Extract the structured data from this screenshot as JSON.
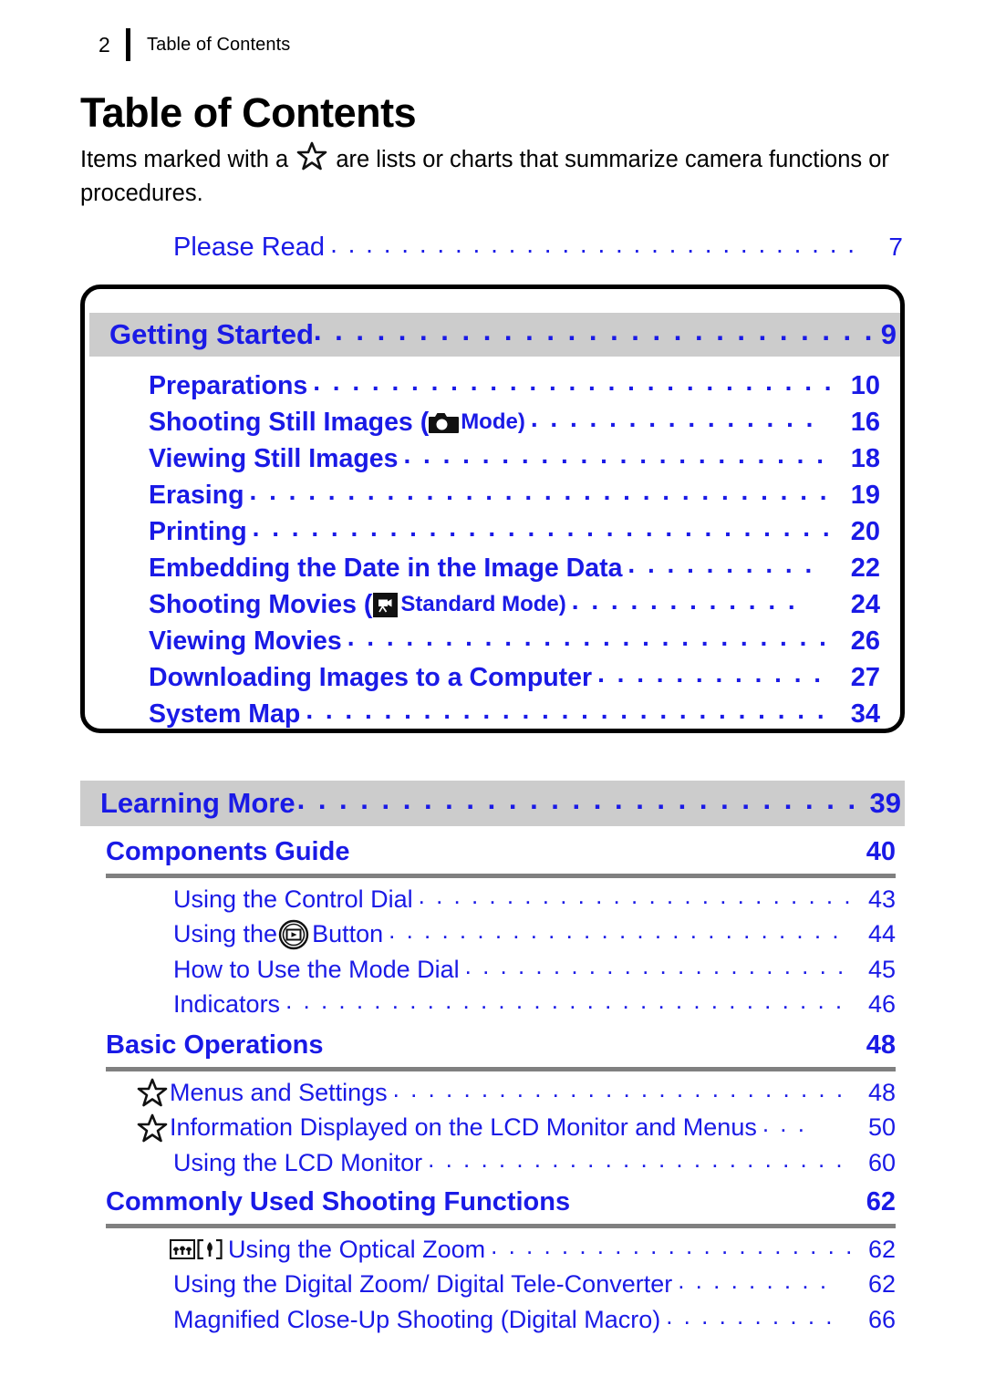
{
  "header": {
    "folio": "2",
    "title": "Table of Contents"
  },
  "title": "Table of Contents",
  "intro": {
    "before_star": "Items marked with a ",
    "star_icon": "star-icon",
    "after_star": " are lists or charts that summarize camera functions or procedures."
  },
  "colors": {
    "link_blue": "#1a1ae6",
    "banner_gray": "#cccccc",
    "rule_gray": "#808080",
    "text_black": "#000000"
  },
  "please_read": {
    "label": "Please Read",
    "leader": ". . . . . . . . . . . . . . . . . . . . . . . . . . . . . . . . . . . . .",
    "page": "7"
  },
  "getting_started": {
    "banner": {
      "label": "Getting Started",
      "leader": ". . . . . . . . . . . . . . . . . . . . . . . . . . . . . . .",
      "page": "9"
    },
    "entries": [
      {
        "label": "Preparations",
        "leader": ". . . . . . . . . . . . . . . . . . . . . . . . . . . . . .",
        "page": "10"
      },
      {
        "label_pre": "Shooting Still Images (",
        "icon": "camera-icon",
        "label_mid": " Mode)",
        "leader": ". . . . . . . . . . . . . . .",
        "page": "16"
      },
      {
        "label": "Viewing Still Images",
        "leader": ". . . . . . . . . . . . . . . . . . . . . . . . . .",
        "page": "18"
      },
      {
        "label": "Erasing",
        "leader": ". . . . . . . . . . . . . . . . . . . . . . . . . . . . . . . . .",
        "page": "19"
      },
      {
        "label": "Printing",
        "leader": ". . . . . . . . . . . . . . . . . . . . . . . . . . . . . . . .",
        "page": "20"
      },
      {
        "label": "Embedding the Date in the Image Data",
        "leader": ". . . . . . . . . .",
        "page": "22"
      },
      {
        "label_pre": "Shooting Movies (",
        "icon": "movie-icon",
        "label_mid": " Standard Mode)",
        "leader": ". . . . . . . . . . . .",
        "page": "24"
      },
      {
        "label": "Viewing Movies",
        "leader": ". . . . . . . . . . . . . . . . . . . . . . . . . . . . .",
        "page": "26"
      },
      {
        "label": "Downloading Images to a Computer",
        "leader": ". . . . . . . . . . . .",
        "page": "27"
      },
      {
        "label": "System Map",
        "leader": ". . . . . . . . . . . . . . . . . . . . . . . . . . . . . .",
        "page": "34"
      }
    ]
  },
  "learning_more": {
    "banner": {
      "label": "Learning More",
      "leader": ". . . . . . . . . . . . . . . . . . . . . . . . . . . . . . . .",
      "page": "39"
    },
    "sections": [
      {
        "heading": "Components Guide",
        "page": "40",
        "entries": [
          {
            "label": "Using the Control Dial",
            "leader": ". . . . . . . . . . . . . . . . . . . . . . . . . .",
            "page": "43"
          },
          {
            "label_pre": "Using the ",
            "icon": "playback-button-icon",
            "label_mid": " Button",
            "leader": ". . . . . . . . . . . . . . . . . . . . . . . . . . .",
            "page": "44"
          },
          {
            "label": "How to Use the Mode Dial",
            "leader": ". . . . . . . . . . . . . . . . . . . . . . .",
            "page": "45"
          },
          {
            "label": "Indicators",
            "leader": ". . . . . . . . . . . . . . . . . . . . . . . . . . . . . . . . . . .",
            "page": "46"
          }
        ]
      },
      {
        "heading": "Basic Operations",
        "page": "48",
        "entries": [
          {
            "star": true,
            "label": "Menus and Settings",
            "leader": ". . . . . . . . . . . . . . . . . . . . . . . . . . . .",
            "page": "48"
          },
          {
            "star": true,
            "label": "Information Displayed on the LCD Monitor and Menus",
            "leader": ". . .",
            "page": "50"
          },
          {
            "label": "Using the LCD Monitor",
            "leader": ". . . . . . . . . . . . . . . . . . . . . . . . . .",
            "page": "60"
          }
        ]
      },
      {
        "heading": "Commonly Used Shooting Functions",
        "page": "62",
        "entries": [
          {
            "zoom_icons": true,
            "label": "Using the Optical Zoom",
            "leader": ". . . . . . . . . . . . . . . . . . . . . .",
            "page": "62"
          },
          {
            "label": "Using the Digital Zoom/ Digital Tele-Converter",
            "leader": ". . . . . . . . .",
            "page": "62"
          },
          {
            "label": "Magnified Close-Up Shooting (Digital Macro)",
            "leader": ". . . . . . . . . .",
            "page": "66"
          }
        ]
      }
    ]
  }
}
